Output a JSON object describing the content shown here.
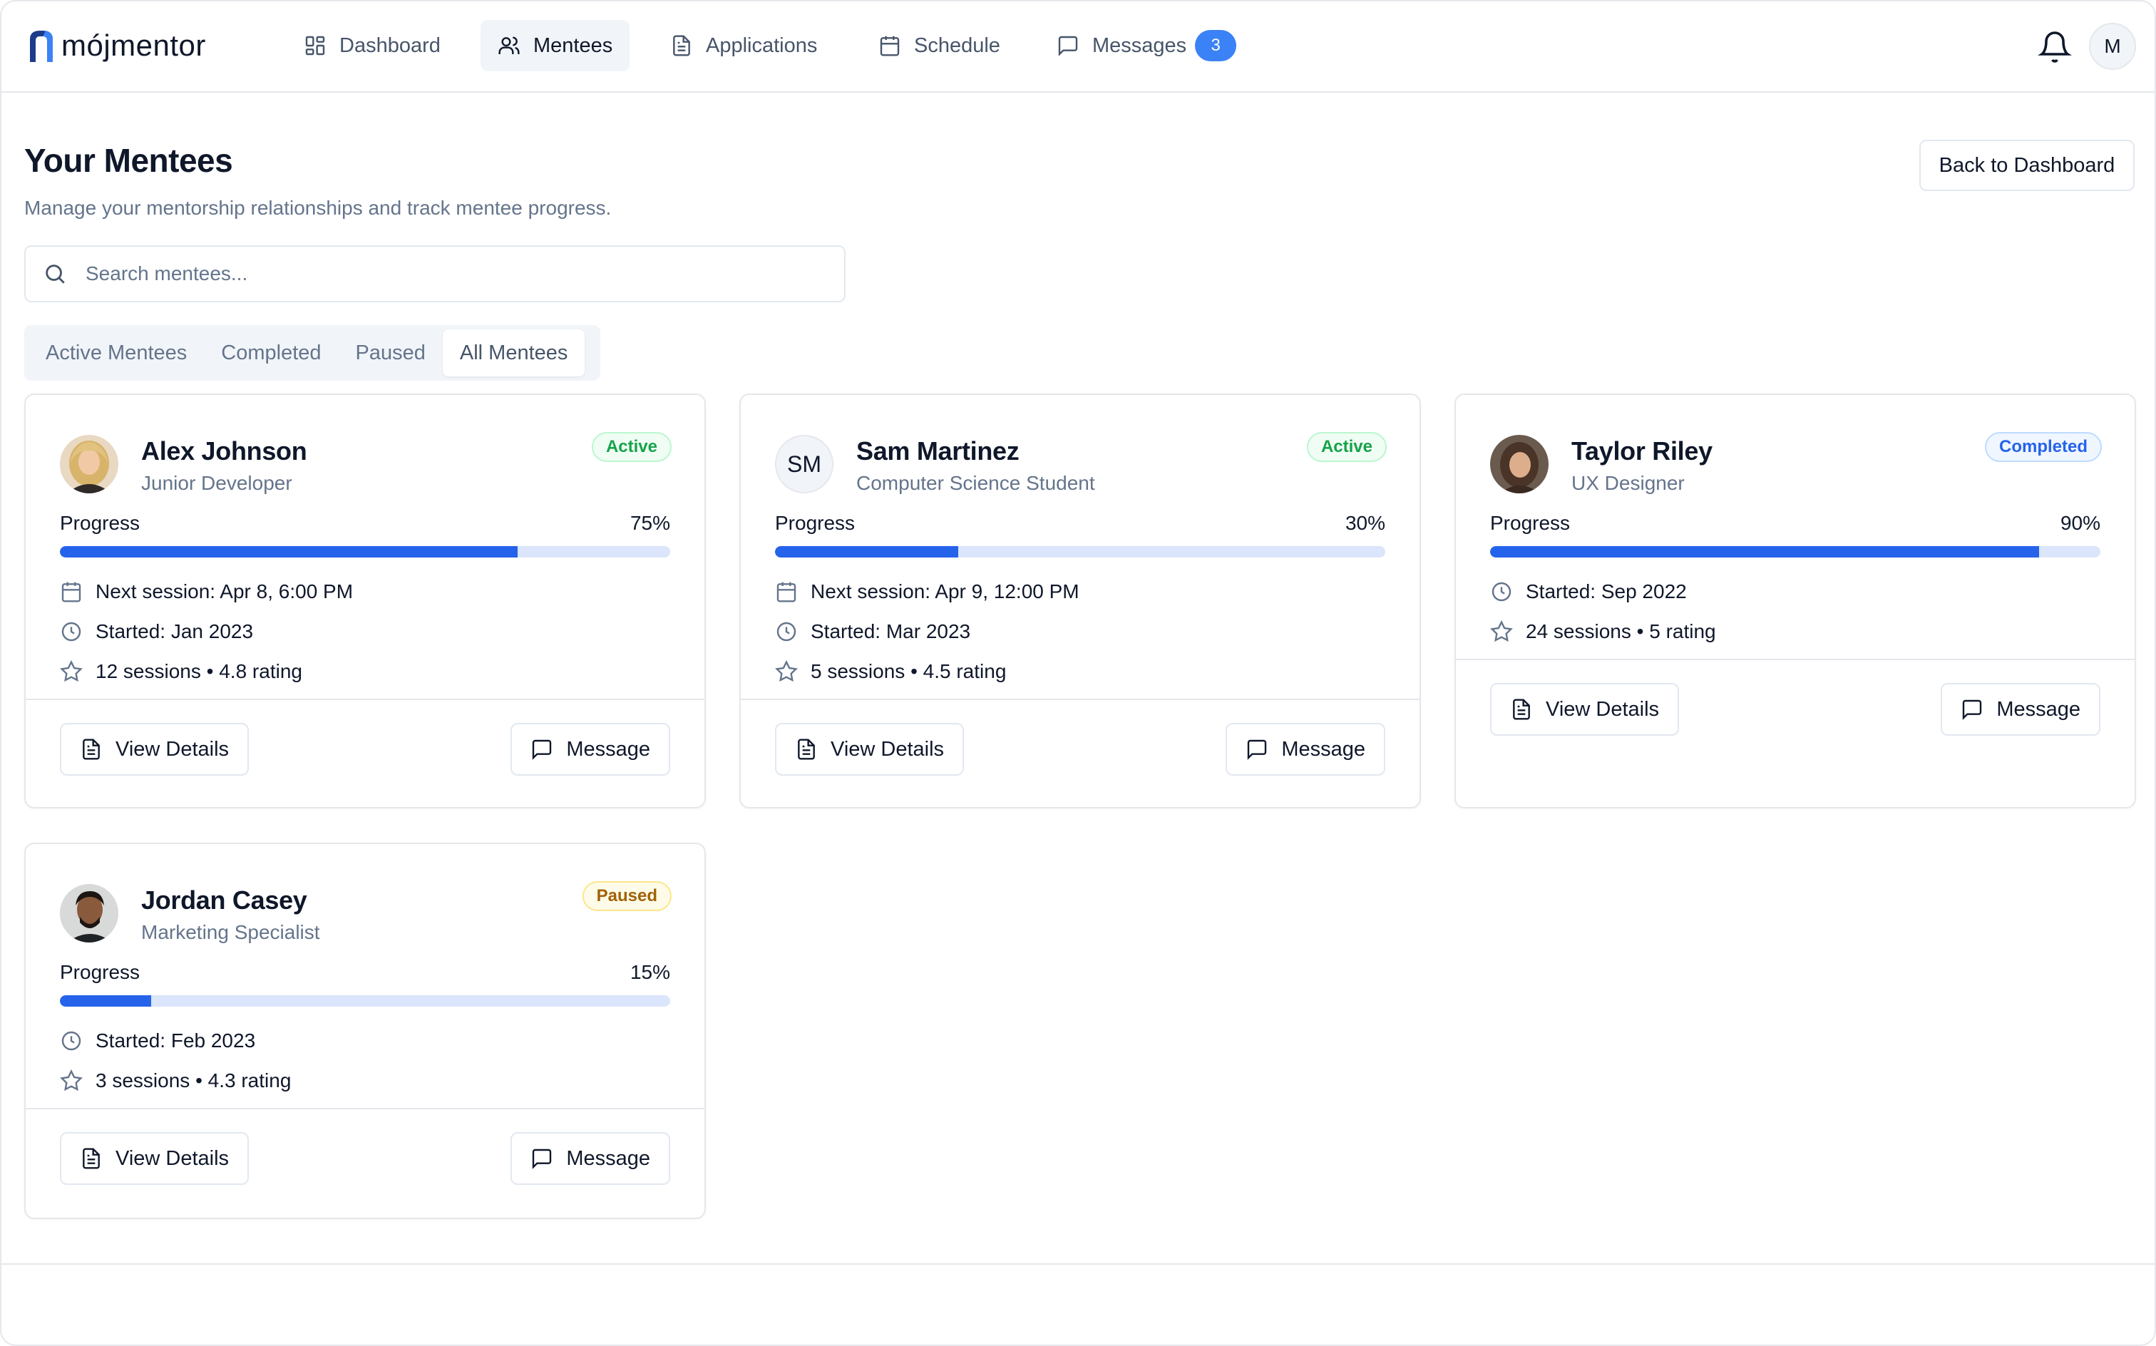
{
  "brand": {
    "name": "mójmentor"
  },
  "nav": {
    "items": [
      {
        "label": "Dashboard",
        "icon": "dashboard-icon"
      },
      {
        "label": "Mentees",
        "icon": "users-icon"
      },
      {
        "label": "Applications",
        "icon": "document-icon"
      },
      {
        "label": "Schedule",
        "icon": "calendar-icon"
      },
      {
        "label": "Messages",
        "icon": "message-icon",
        "badge": "3"
      }
    ],
    "active": "Mentees"
  },
  "user": {
    "initial": "M"
  },
  "page": {
    "title": "Your Mentees",
    "subtitle": "Manage your mentorship relationships and track mentee progress.",
    "back_button": "Back to Dashboard"
  },
  "search": {
    "placeholder": "Search mentees...",
    "value": ""
  },
  "tabs": [
    {
      "label": "Active Mentees"
    },
    {
      "label": "Completed"
    },
    {
      "label": "Paused"
    },
    {
      "label": "All Mentees"
    }
  ],
  "active_tab": "All Mentees",
  "progress_label": "Progress",
  "view_details_label": "View Details",
  "message_label": "Message",
  "colors": {
    "accent": "#2563eb",
    "badge": "#3b82f6",
    "active_status": "#16a34a",
    "completed_status": "#2563eb",
    "paused_status": "#a16207"
  },
  "mentees": [
    {
      "name": "Alex Johnson",
      "role": "Junior Developer",
      "status": "Active",
      "progress": 75,
      "progress_text": "75%",
      "next_session": "Next session: Apr 8, 6:00 PM",
      "started": "Started: Jan 2023",
      "sessions_rating": "12 sessions • 4.8 rating"
    },
    {
      "name": "Sam Martinez",
      "role": "Computer Science Student",
      "status": "Active",
      "initials": "SM",
      "progress": 30,
      "progress_text": "30%",
      "next_session": "Next session: Apr 9, 12:00 PM",
      "started": "Started: Mar 2023",
      "sessions_rating": "5 sessions • 4.5 rating"
    },
    {
      "name": "Taylor Riley",
      "role": "UX Designer",
      "status": "Completed",
      "progress": 90,
      "progress_text": "90%",
      "started": "Started: Sep 2022",
      "sessions_rating": "24 sessions • 5 rating"
    },
    {
      "name": "Jordan Casey",
      "role": "Marketing Specialist",
      "status": "Paused",
      "progress": 15,
      "progress_text": "15%",
      "started": "Started: Feb 2023",
      "sessions_rating": "3 sessions • 4.3 rating"
    }
  ]
}
